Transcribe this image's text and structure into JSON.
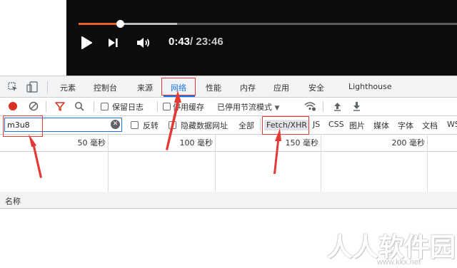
{
  "player": {
    "current_time": "0:43",
    "duration": "/ 23:46",
    "progress_played": 0.11,
    "progress_buffered": 0.26,
    "colors": {
      "played": "#e8622c",
      "background": "#0c0c0c"
    },
    "icons": {
      "play": "play-icon",
      "next": "next-icon",
      "volume": "volume-icon"
    }
  },
  "devtools": {
    "tabs": [
      {
        "label": "元素"
      },
      {
        "label": "控制台"
      },
      {
        "label": "来源"
      },
      {
        "label": "网络",
        "active": true
      },
      {
        "label": "性能"
      },
      {
        "label": "内存"
      },
      {
        "label": "应用"
      },
      {
        "label": "安全"
      },
      {
        "label": "Lighthouse"
      }
    ],
    "toolbar": {
      "preserve_log": "保留日志",
      "disable_cache": "停用缓存",
      "throttling": "已停用节流模式"
    },
    "filter": {
      "value": "m3u8",
      "invert": "反转",
      "hide_data_urls": "隐藏数据网址",
      "types": [
        "全部",
        "Fetch/XHR",
        "JS",
        "CSS",
        "图片",
        "媒体",
        "字体",
        "文档",
        "WS"
      ]
    },
    "timeline": {
      "ticks": [
        "50 毫秒",
        "100 毫秒",
        "150 毫秒",
        "200 毫秒"
      ]
    },
    "columns": {
      "name": "名称"
    },
    "accent": "#1a73e8"
  },
  "watermark": {
    "text": "人人软件园",
    "url": "www.kkx.net"
  }
}
